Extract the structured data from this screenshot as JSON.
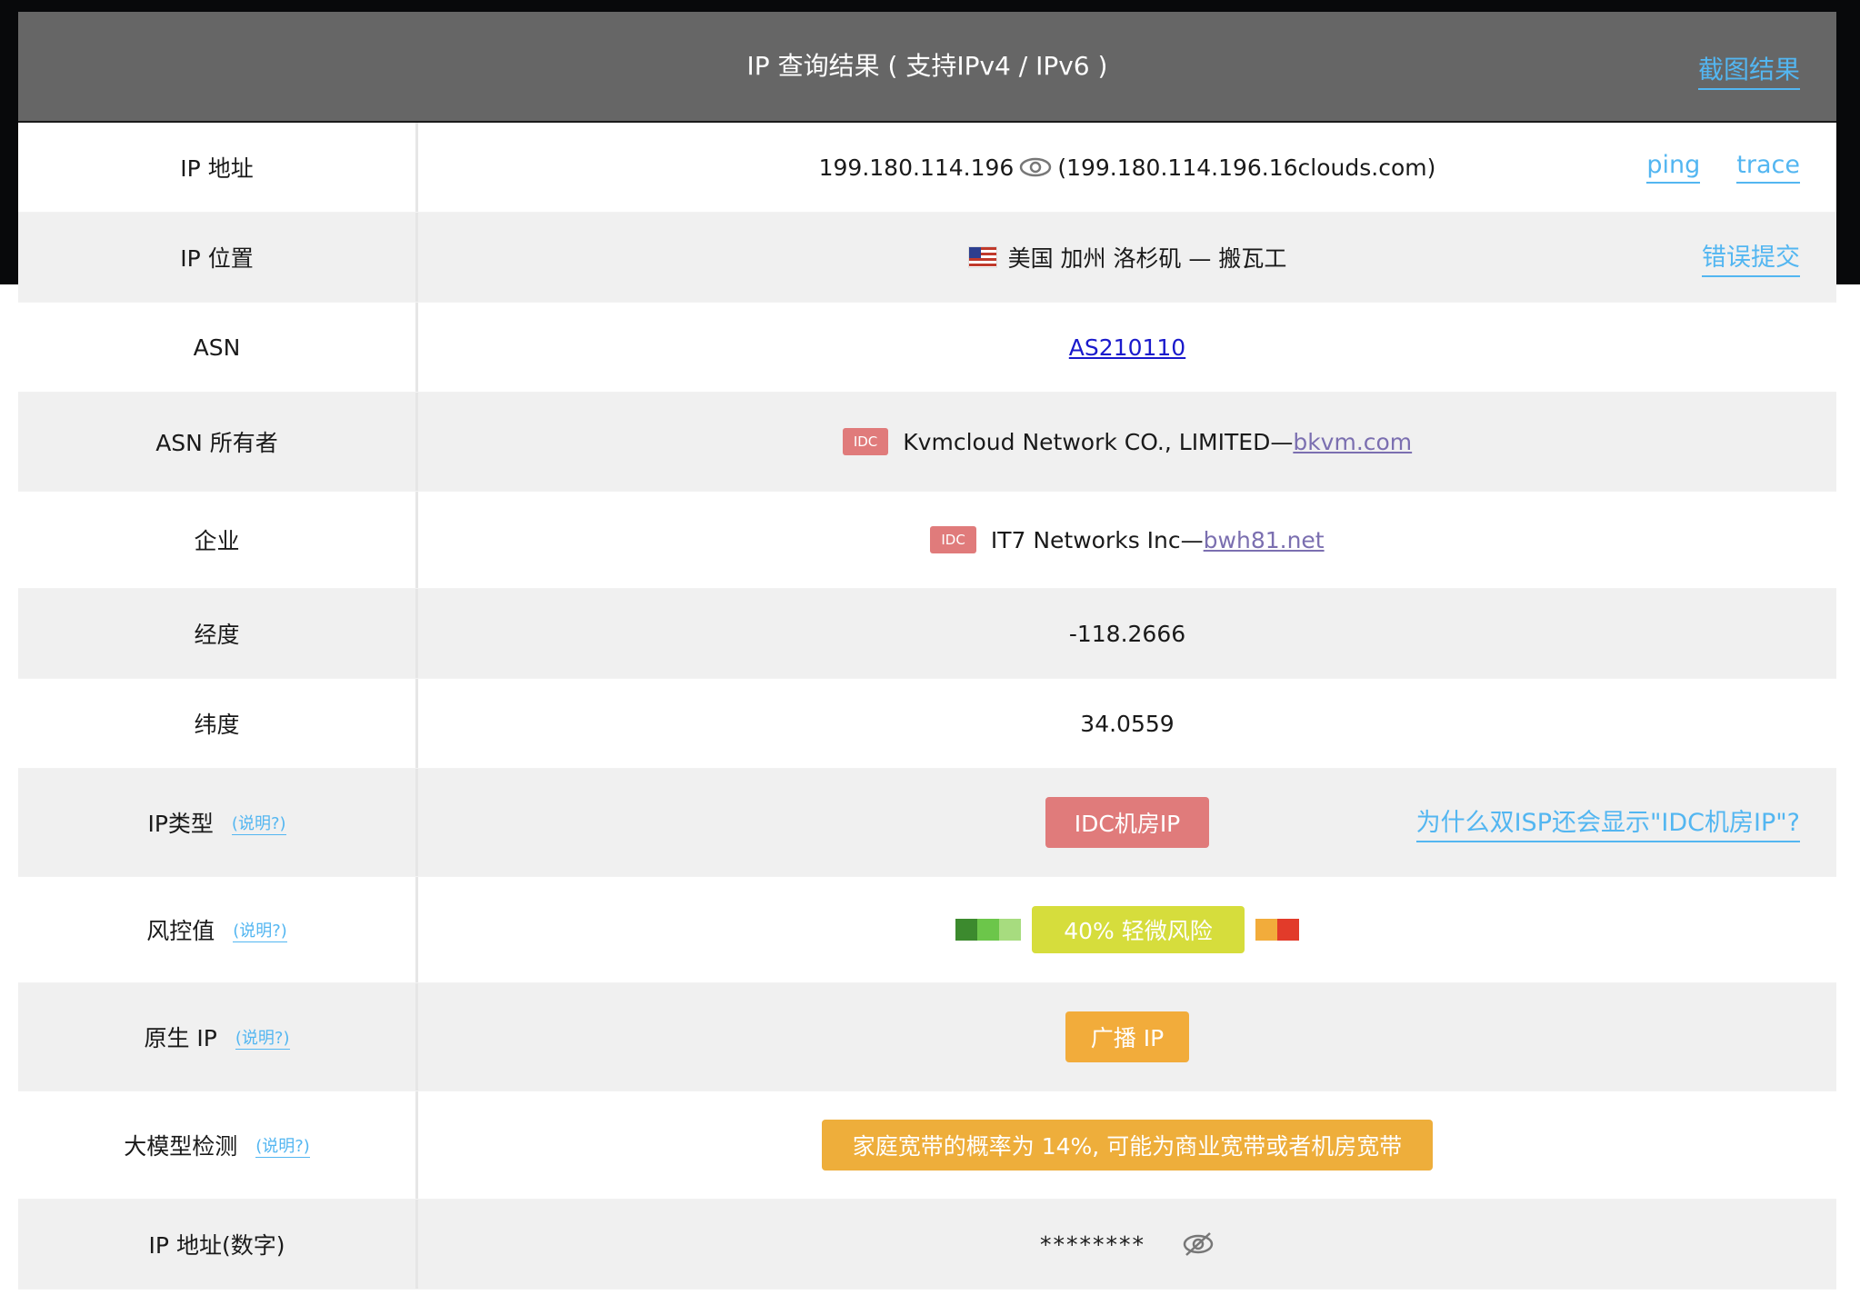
{
  "header": {
    "title": "IP 查询结果 ( 支持IPv4 / IPv6 )",
    "screenshot_link": "截图结果"
  },
  "rows": {
    "ip": {
      "label": "IP 地址",
      "address": "199.180.114.196",
      "hostname": "(199.180.114.196.16clouds.com)",
      "ping": "ping",
      "trace": "trace"
    },
    "location": {
      "label": "IP 位置",
      "value": "美国 加州 洛杉矶 — 搬瓦工",
      "report_error": "错误提交"
    },
    "asn": {
      "label": "ASN",
      "value": "AS210110"
    },
    "asn_owner": {
      "label": "ASN 所有者",
      "badge": "IDC",
      "name": "Kvmcloud Network CO., LIMITED—",
      "domain": "bkvm.com"
    },
    "company": {
      "label": "企业",
      "badge": "IDC",
      "name": "IT7 Networks Inc—",
      "domain": "bwh81.net"
    },
    "longitude": {
      "label": "经度",
      "value": "-118.2666"
    },
    "latitude": {
      "label": "纬度",
      "value": "34.0559"
    },
    "ip_type": {
      "label": "IP类型",
      "help": "(说明?)",
      "value": "IDC机房IP",
      "why_link": "为什么双ISP还会显示\"IDC机房IP\"?"
    },
    "risk": {
      "label": "风控值",
      "help": "(说明?)",
      "value": "40%  轻微风险",
      "percent": 40
    },
    "native_ip": {
      "label": "原生 IP",
      "help": "(说明?)",
      "value": "广播 IP"
    },
    "llm_check": {
      "label": "大模型检测",
      "help": "(说明?)",
      "value": "家庭宽带的概率为 14%, 可能为商业宽带或者机房宽带"
    },
    "ip_numeric": {
      "label": "IP 地址(数字)",
      "value": "********"
    }
  },
  "colors": {
    "header_bg": "#666666",
    "link_blue": "#53b6f1",
    "idc_red": "#e07b7b",
    "risk_yellow": "#d6dd3c",
    "broadcast_orange": "#f2ac3b",
    "llm_orange": "#eeae3b"
  },
  "icons": {
    "eye": "eye-icon",
    "eye_hidden": "eye-off-icon",
    "flag": "us-flag-icon"
  }
}
